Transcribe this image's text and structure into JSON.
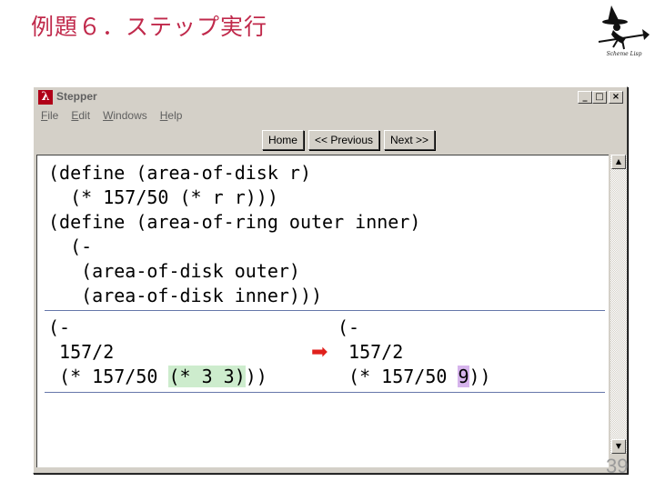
{
  "slide": {
    "title": "例題６．ステップ実行",
    "page_number": "39"
  },
  "logo": {
    "caption": "Scheme Lisp"
  },
  "window": {
    "title": "Stepper",
    "app_icon_glyph": "λ",
    "controls": {
      "minimize": "_",
      "maximize": "□",
      "close": "×"
    }
  },
  "menu": [
    "File",
    "Edit",
    "Windows",
    "Help"
  ],
  "nav": {
    "home": "Home",
    "previous": "<< Previous",
    "next": "Next >>"
  },
  "code": {
    "definitions": [
      "(define (area-of-disk r)",
      "  (* 157/50 (* r r)))",
      "(define (area-of-ring outer inner)",
      "  (-",
      "   (area-of-disk outer)",
      "   (area-of-disk inner)))"
    ],
    "before": {
      "line1": "(-",
      "line2": " 157/2",
      "line3_pre": " (* 157/50 ",
      "line3_highlight": "(* 3 3)",
      "line3_post": "))"
    },
    "after": {
      "line1": "(-",
      "line2": " 157/2",
      "line3_pre": " (* 157/50 ",
      "line3_highlight": "9",
      "line3_post": "))"
    },
    "arrow_glyph": "➡"
  },
  "colors": {
    "title": "#c0294b",
    "arrow": "#e0201c",
    "redex": "#cdeccd",
    "contractum": "#d6b4ec"
  }
}
